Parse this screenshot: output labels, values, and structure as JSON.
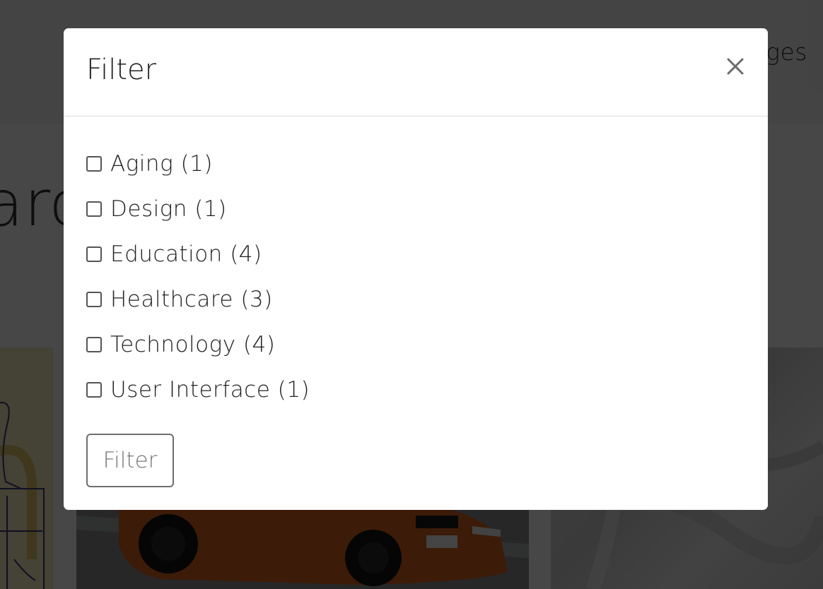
{
  "background": {
    "nav_link_partial": "ges",
    "heading_partial": "arc"
  },
  "modal": {
    "title": "Filter",
    "close_icon": "close-icon",
    "options": [
      {
        "label": "Aging (1)",
        "checked": false
      },
      {
        "label": "Design (1)",
        "checked": false
      },
      {
        "label": "Education (4)",
        "checked": false
      },
      {
        "label": "Healthcare (3)",
        "checked": false
      },
      {
        "label": "Technology (4)",
        "checked": false
      },
      {
        "label": "User Interface (1)",
        "checked": false
      }
    ],
    "submit_label": "Filter"
  },
  "colors": {
    "backdrop": "#000000b8",
    "modal_bg": "#ffffff",
    "text": "#222222",
    "button_border": "#6e6e6e",
    "button_text": "#777777"
  }
}
